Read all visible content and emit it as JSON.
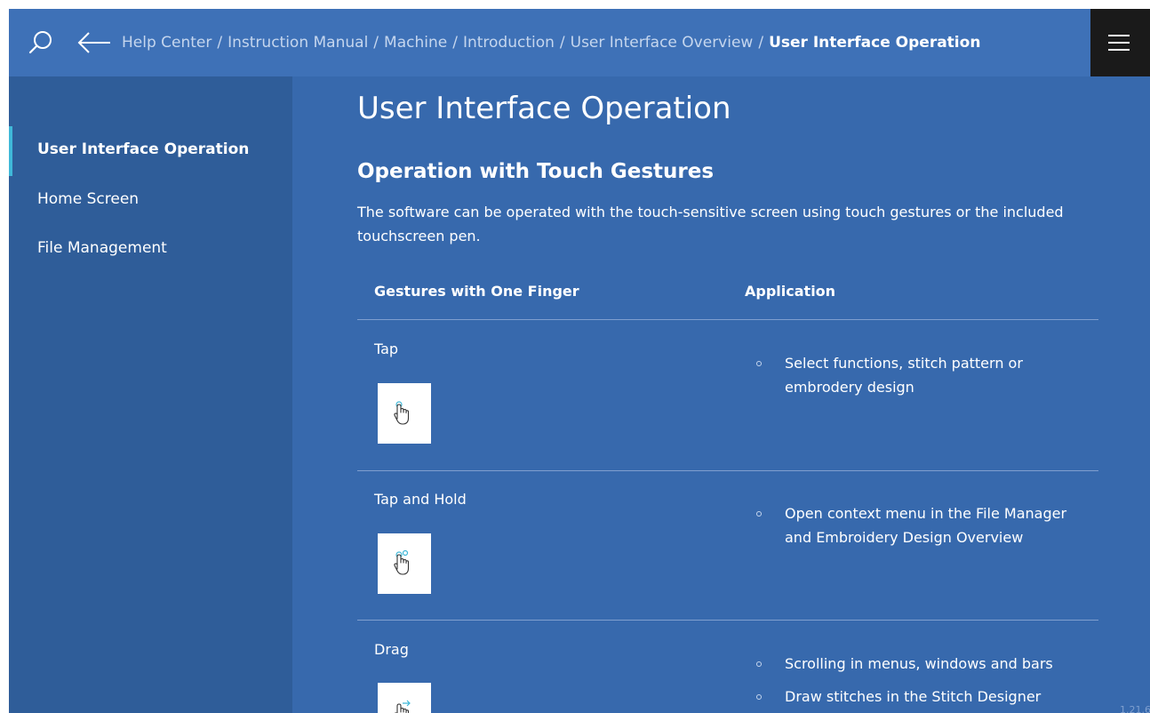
{
  "header": {
    "breadcrumbs": [
      "Help Center",
      "Instruction Manual",
      "Machine",
      "Introduction",
      "User Interface Overview"
    ],
    "current_page": "User Interface Operation",
    "separator": "/",
    "icons": {
      "search": "search-icon",
      "back": "arrow-left-icon",
      "menu": "hamburger-menu-icon"
    }
  },
  "sidebar": {
    "items": [
      {
        "label": "User Interface Operation",
        "active": true
      },
      {
        "label": "Home Screen",
        "active": false
      },
      {
        "label": "File Management",
        "active": false
      }
    ]
  },
  "main": {
    "title": "User Interface Operation",
    "section_title": "Operation with Touch Gestures",
    "intro": "The software can be operated with the touch-sensitive screen using touch gestures or the included touchscreen pen.",
    "table": {
      "headers": [
        "Gestures with One Finger",
        "Application"
      ],
      "rows": [
        {
          "gesture": "Tap",
          "icon": "tap-gesture-icon",
          "applications": [
            "Select functions, stitch pattern or embrodery design"
          ]
        },
        {
          "gesture": "Tap and Hold",
          "icon": "tap-hold-gesture-icon",
          "applications": [
            "Open context menu in the File Manager and Embroidery Design Overview"
          ]
        },
        {
          "gesture": "Drag",
          "icon": "drag-gesture-icon",
          "applications": [
            "Scrolling in menus, windows and bars",
            "Draw stitches in the Stitch Designer"
          ]
        }
      ]
    }
  },
  "footer": {
    "version": "1.21.6"
  },
  "colors": {
    "background": "#3769ad",
    "topbar": "#3e71b7",
    "sidebar": "#2f5d99",
    "menu_button": "#1a1a1a",
    "active_indicator": "#3fb8d8"
  }
}
